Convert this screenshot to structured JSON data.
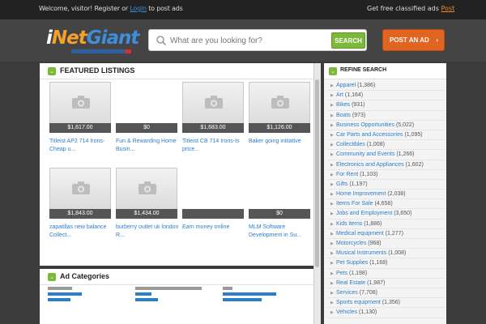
{
  "topbar": {
    "left_prefix": "Welcome, visitor! Register or",
    "left_link": "Login",
    "left_suffix": "to post ads",
    "right_prefix": "Get free classified ads",
    "right_link": "Post"
  },
  "header": {
    "logo_i": "i",
    "logo_net": "Net",
    "logo_giant": "Giant",
    "search_placeholder": "What are you looking for?",
    "search_button": "SEARCH",
    "post_button": "POST AN AD",
    "post_arrow": "›"
  },
  "featured": {
    "title": "FEATURED LISTINGS",
    "chevron": "⌄",
    "items": [
      {
        "price": "$1,617.00",
        "title": "Titleist AP2 714 Irons-Cheap u..."
      },
      {
        "price": "$0",
        "title": "Fun & Rewarding Home Busin..."
      },
      {
        "price": "",
        "title": ""
      },
      {
        "price": "$1,683.00",
        "title": "Titleist CB 714 Irons-Is price..."
      },
      {
        "price": "$1,126.00",
        "title": "Baker going initiative"
      },
      {
        "price": "$1,843.00",
        "title": "zapatillas new balance Collect..."
      },
      {
        "price": "$1,434.00",
        "title": "burberry outlet uk london R..."
      },
      {
        "price": "",
        "title": "Earn money online"
      },
      {
        "price": "$0",
        "title": "MLM Software Development in Su..."
      }
    ]
  },
  "adcats": {
    "title": "Ad Categories",
    "chevron": "⌄"
  },
  "refine": {
    "title": "REFINE SEARCH",
    "chevron": "⌄",
    "items": [
      {
        "name": "Apparel",
        "count": "(1,386)"
      },
      {
        "name": "Art",
        "count": "(1,164)"
      },
      {
        "name": "Bikes",
        "count": "(931)"
      },
      {
        "name": "Boats",
        "count": "(973)"
      },
      {
        "name": "Business Opportunities",
        "count": "(5,022)"
      },
      {
        "name": "Car Parts and Accessories",
        "count": "(1,095)"
      },
      {
        "name": "Collectibles",
        "count": "(1,008)"
      },
      {
        "name": "Community and Events",
        "count": "(1,266)"
      },
      {
        "name": "Electronics and Appliances",
        "count": "(1,602)"
      },
      {
        "name": "For Rent",
        "count": "(1,103)"
      },
      {
        "name": "Gifts",
        "count": "(1,197)"
      },
      {
        "name": "Home Improvement",
        "count": "(2,038)"
      },
      {
        "name": "Items For Sale",
        "count": "(4,658)"
      },
      {
        "name": "Jobs and Employment",
        "count": "(3,650)"
      },
      {
        "name": "Kids items",
        "count": "(1,886)"
      },
      {
        "name": "Medical equipment",
        "count": "(1,277)"
      },
      {
        "name": "Motorcycles",
        "count": "(968)"
      },
      {
        "name": "Musical Instruments",
        "count": "(1,008)"
      },
      {
        "name": "Pet Supplies",
        "count": "(1,168)"
      },
      {
        "name": "Pets",
        "count": "(1,198)"
      },
      {
        "name": "Real Estate",
        "count": "(1,987)"
      },
      {
        "name": "Services",
        "count": "(7,708)"
      },
      {
        "name": "Sports equipment",
        "count": "(1,356)"
      },
      {
        "name": "Vehicles",
        "count": "(1,130)"
      }
    ]
  },
  "colors": {
    "accent_green": "#7cb83a",
    "accent_orange": "#e06520",
    "link_blue": "#2d7ec8"
  }
}
